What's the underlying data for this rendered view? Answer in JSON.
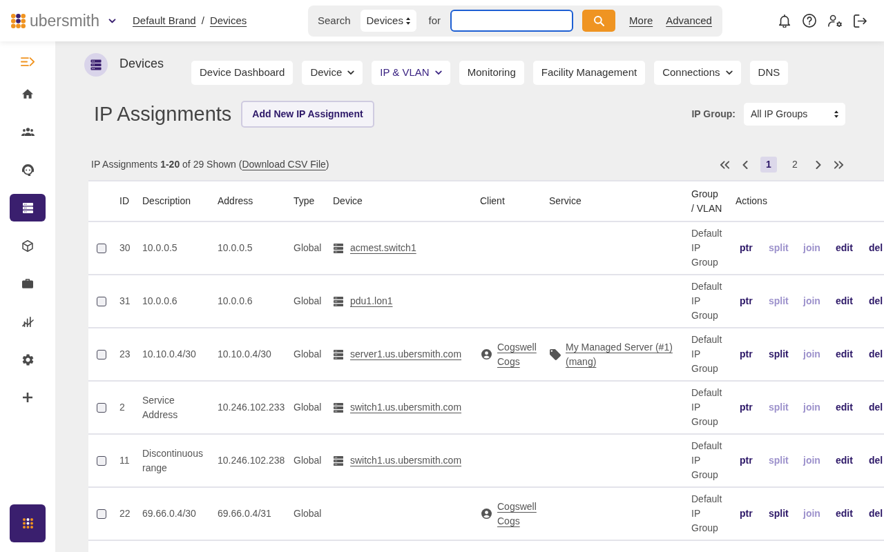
{
  "top_bar": {
    "brand": "ubersmith",
    "breadcrumb": {
      "items": [
        "Default Brand",
        "Devices"
      ],
      "separator": "/"
    },
    "search": {
      "label": "Search",
      "scope": "Devices",
      "for_label": "for",
      "focused": true,
      "links": [
        "More",
        "Advanced"
      ]
    }
  },
  "sidebar": {
    "items": [
      {
        "kind": "collapse",
        "selected": false
      },
      {
        "kind": "home",
        "selected": false
      },
      {
        "kind": "clients",
        "selected": false
      },
      {
        "kind": "support",
        "selected": false
      },
      {
        "kind": "devices",
        "selected": true
      },
      {
        "kind": "packages",
        "selected": false
      },
      {
        "kind": "sales",
        "selected": false
      },
      {
        "kind": "reports",
        "selected": false
      },
      {
        "kind": "settings",
        "selected": false
      },
      {
        "kind": "add",
        "selected": false
      }
    ]
  },
  "module": {
    "title": "Devices",
    "tabs": [
      {
        "label": "Device Dashboard",
        "selected": false,
        "dropdown": false
      },
      {
        "label": "Device",
        "selected": false,
        "dropdown": true
      },
      {
        "label": "IP & VLAN",
        "selected": true,
        "dropdown": true
      },
      {
        "label": "Monitoring",
        "selected": false,
        "dropdown": false
      },
      {
        "label": "Facility Management",
        "selected": false,
        "dropdown": false
      },
      {
        "label": "Connections",
        "selected": false,
        "dropdown": true
      },
      {
        "label": "DNS",
        "selected": false,
        "dropdown": false
      }
    ]
  },
  "page": {
    "title": "IP Assignments",
    "add_button": "Add New IP Assignment",
    "filter_label": "IP Group:",
    "filter_value": "All IP Groups"
  },
  "summary": {
    "text": "IP Assignments **1-20** of 29 Shown (",
    "link": "Download CSV File",
    "closing": ")"
  },
  "pagination": {
    "pages": [
      {
        "label": "1",
        "selected": true
      },
      {
        "label": "2",
        "selected": false
      }
    ]
  },
  "table": {
    "columns": [
      "ID",
      "Description",
      "Address",
      "Type",
      "Device",
      "Client",
      "Service",
      "Group / VLAN",
      "Actions"
    ],
    "rows": [
      {
        "checked": false,
        "id": "30",
        "description": "10.0.0.5",
        "address": "10.0.0.5",
        "type": "Global",
        "device": "acmest.switch1",
        "group": "Default IP Group",
        "actions": [
          {
            "label": "ptr",
            "disabled": false
          },
          {
            "label": "split",
            "disabled": true
          },
          {
            "label": "join",
            "disabled": true
          },
          {
            "label": "edit",
            "disabled": false
          },
          {
            "label": "del",
            "disabled": false
          }
        ]
      },
      {
        "checked": false,
        "id": "31",
        "description": "10.0.0.6",
        "address": "10.0.0.6",
        "type": "Global",
        "device": "pdu1.lon1",
        "group": "Default IP Group",
        "actions": [
          {
            "label": "ptr",
            "disabled": false
          },
          {
            "label": "split",
            "disabled": true
          },
          {
            "label": "join",
            "disabled": true
          },
          {
            "label": "edit",
            "disabled": false
          },
          {
            "label": "del",
            "disabled": false
          }
        ]
      },
      {
        "checked": false,
        "id": "23",
        "description": "10.10.0.4/30",
        "address": "10.10.0.4/30",
        "type": "Global",
        "device": "server1.us.ubersmith.com",
        "client": "Cogswell Cogs",
        "service": "My Managed Server (#1) (mang)",
        "group": "Default IP Group",
        "actions": [
          {
            "label": "ptr",
            "disabled": false
          },
          {
            "label": "split",
            "disabled": false
          },
          {
            "label": "join",
            "disabled": true
          },
          {
            "label": "edit",
            "disabled": false
          },
          {
            "label": "del",
            "disabled": false
          }
        ]
      },
      {
        "checked": false,
        "id": "2",
        "description": "Service Address",
        "address": "10.246.102.233",
        "type": "Global",
        "device": "switch1.us.ubersmith.com",
        "group": "Default IP Group",
        "actions": [
          {
            "label": "ptr",
            "disabled": false
          },
          {
            "label": "split",
            "disabled": true
          },
          {
            "label": "join",
            "disabled": true
          },
          {
            "label": "edit",
            "disabled": false
          },
          {
            "label": "del",
            "disabled": false
          }
        ]
      },
      {
        "checked": false,
        "id": "11",
        "description": "Discontinuous range",
        "address": "10.246.102.238",
        "type": "Global",
        "device": "switch1.us.ubersmith.com",
        "group": "Default IP Group",
        "actions": [
          {
            "label": "ptr",
            "disabled": false
          },
          {
            "label": "split",
            "disabled": true
          },
          {
            "label": "join",
            "disabled": true
          },
          {
            "label": "edit",
            "disabled": false
          },
          {
            "label": "del",
            "disabled": false
          }
        ]
      },
      {
        "checked": false,
        "id": "22",
        "description": "69.66.0.4/30",
        "address": "69.66.0.4/31",
        "type": "Global",
        "client": "Cogswell Cogs",
        "group": "Default IP Group",
        "actions": [
          {
            "label": "ptr",
            "disabled": false
          },
          {
            "label": "split",
            "disabled": false
          },
          {
            "label": "join",
            "disabled": true
          },
          {
            "label": "edit",
            "disabled": false
          },
          {
            "label": "del",
            "disabled": false
          }
        ]
      }
    ]
  }
}
